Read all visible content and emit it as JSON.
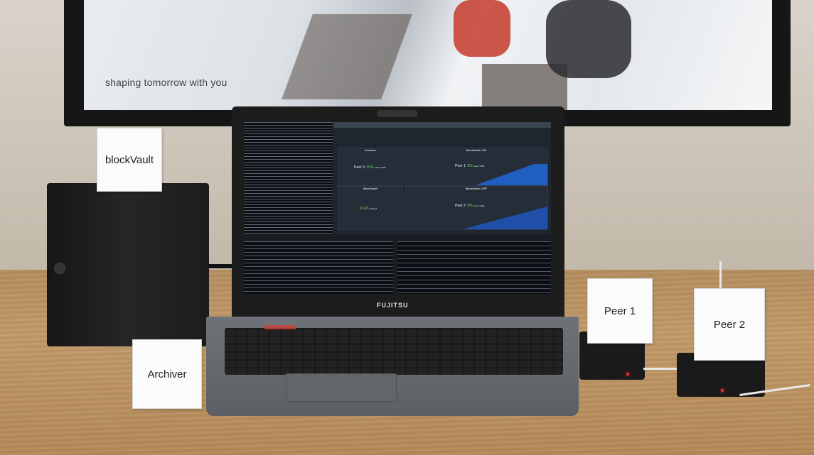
{
  "tv": {
    "tagline": "shaping tomorrow with you"
  },
  "laptop": {
    "brand": "FUJITSU",
    "dashboard": {
      "panels": [
        {
          "title": "Archiver",
          "label": "Peer 0:",
          "value": "15%",
          "unit": "used / 4096"
        },
        {
          "title": "MockVault: ON",
          "label": "Peer 1:",
          "value": "8%",
          "unit": "used / 2GB"
        },
        {
          "title": "MockVault",
          "label": "",
          "value": "0 GB",
          "unit": "archived"
        },
        {
          "title": "MockVault: OFF",
          "label": "Peer 2:",
          "value": "8%",
          "unit": "used / 2GB"
        }
      ]
    }
  },
  "labels": {
    "blockvault": "blockVault",
    "archiver": "Archiver",
    "peer1": "Peer 1",
    "peer2": "Peer 2"
  },
  "colors": {
    "accent_green": "#6fdc5a",
    "chart_blue": "#1f5fbf",
    "led_red": "#ff2a2a"
  }
}
